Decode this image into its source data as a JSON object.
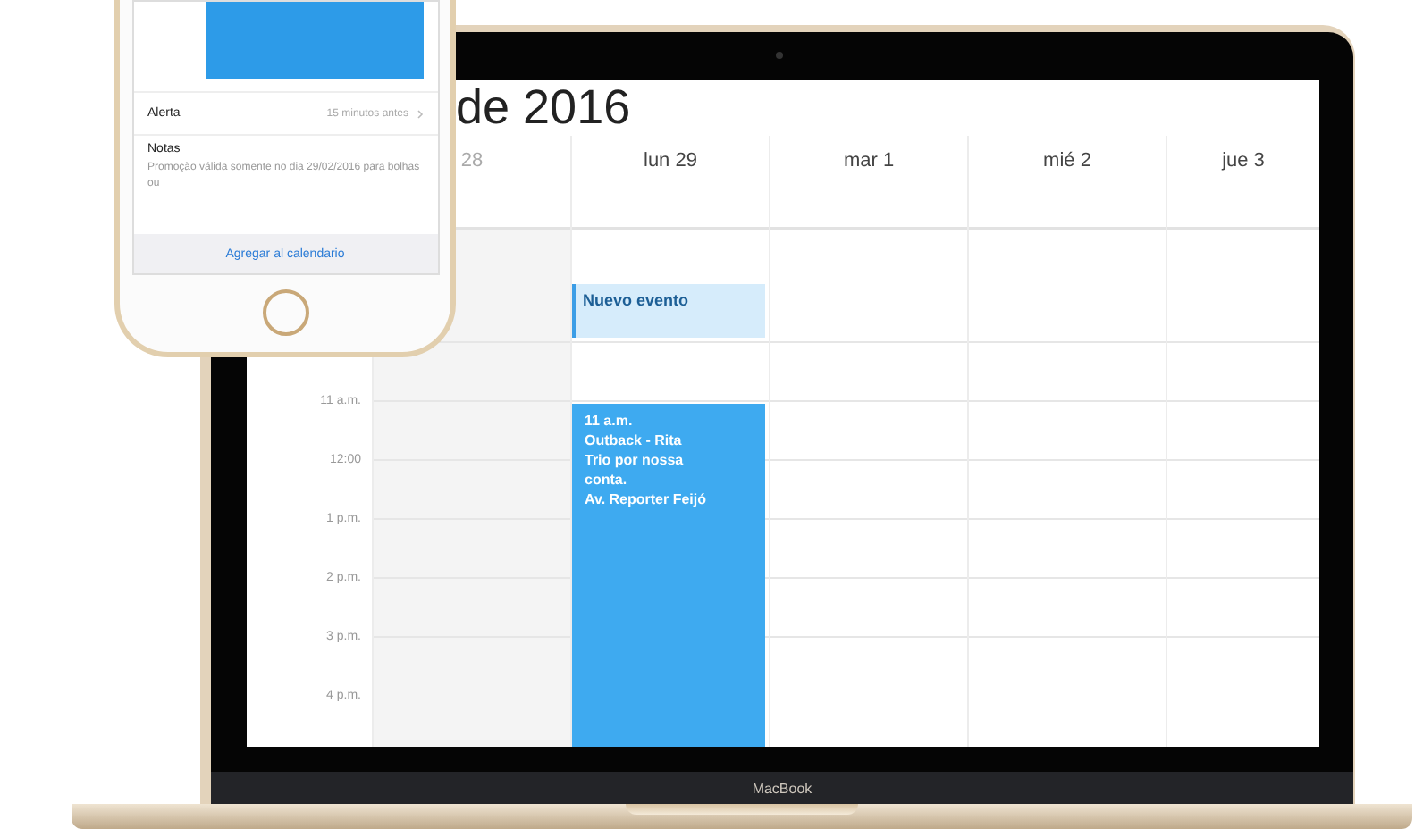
{
  "phone": {
    "alert": {
      "label": "Alerta",
      "value": "15 minutos antes"
    },
    "notes": {
      "label": "Notas",
      "text": "Promoção válida somente no dia 29/02/2016 para bolhas ou"
    },
    "add_button": "Agregar al calendario"
  },
  "calendar": {
    "title": "de 2016",
    "days": [
      {
        "label": "28",
        "weekend": true
      },
      {
        "label": "lun 29",
        "weekend": false,
        "events": [
          {
            "kind": "new",
            "lines": [
              "Nuevo evento"
            ]
          },
          {
            "kind": "block",
            "lines": [
              "11 a.m.",
              "Outback - Rita",
              "Trio por nossa",
              "conta.",
              "Av. Reporter Feijó"
            ]
          }
        ]
      },
      {
        "label": "mar 1",
        "weekend": false
      },
      {
        "label": "mié 2",
        "weekend": false
      },
      {
        "label": "jue 3",
        "weekend": false
      }
    ],
    "times": [
      "11 a.m.",
      "12:00",
      "1 p.m.",
      "2 p.m.",
      "3 p.m.",
      "4 p.m."
    ]
  },
  "laptop": {
    "brand": "MacBook"
  }
}
